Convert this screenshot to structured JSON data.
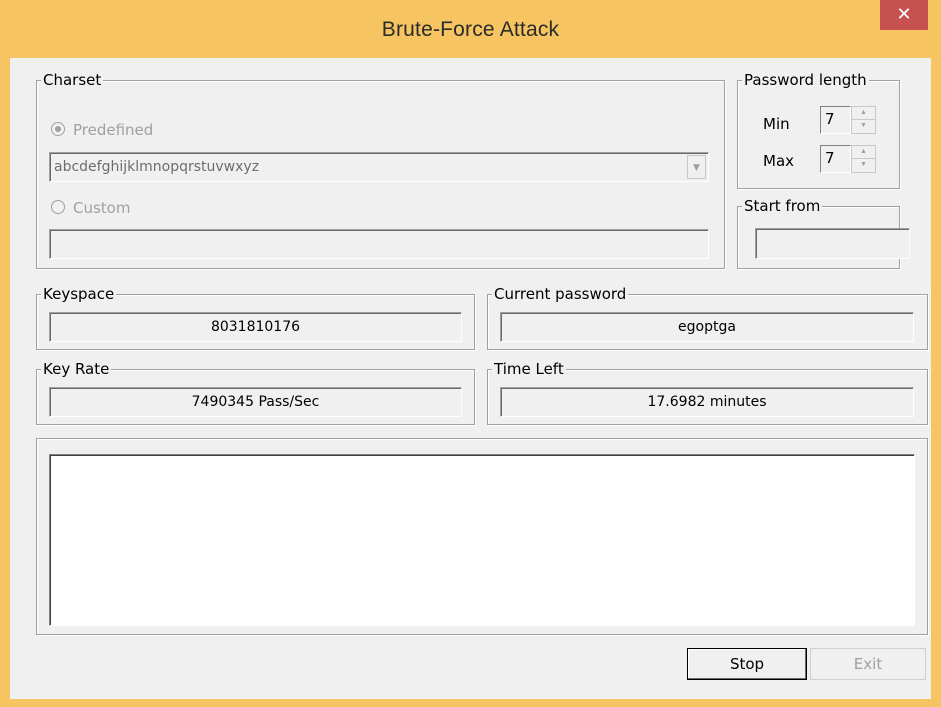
{
  "window": {
    "title": "Brute-Force Attack",
    "close_glyph": "✕"
  },
  "charset": {
    "legend": "Charset",
    "predefined_label": "Predefined",
    "predefined_selected": true,
    "predefined_value": "abcdefghijklmnopqrstuvwxyz",
    "custom_label": "Custom",
    "custom_value": ""
  },
  "password_length": {
    "legend": "Password length",
    "min_label": "Min",
    "min_value": "7",
    "max_label": "Max",
    "max_value": "7"
  },
  "start_from": {
    "legend": "Start from",
    "value": ""
  },
  "keyspace": {
    "legend": "Keyspace",
    "value": "8031810176"
  },
  "current_password": {
    "legend": "Current password",
    "value": "egoptga"
  },
  "key_rate": {
    "legend": "Key Rate",
    "value": "7490345 Pass/Sec"
  },
  "time_left": {
    "legend": "Time Left",
    "value": "17.6982 minutes"
  },
  "buttons": {
    "stop": "Stop",
    "exit": "Exit"
  },
  "icons": {
    "radio": "radio-icon",
    "combo_arrow": "chevron-down-icon",
    "spin_up": "spin-up-icon",
    "spin_down": "spin-down-icon"
  }
}
